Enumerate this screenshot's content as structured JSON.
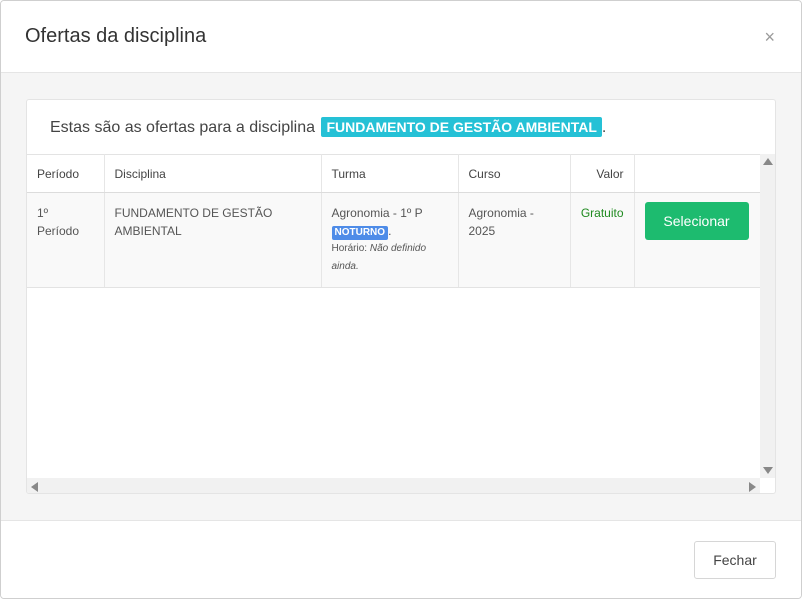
{
  "modal": {
    "title": "Ofertas da disciplina",
    "close_label": "×"
  },
  "intro": {
    "text": "Estas são as ofertas para a disciplina",
    "discipline_tag": "FUNDAMENTO DE GESTÃO AMBIENTAL",
    "suffix": "."
  },
  "table": {
    "headers": [
      "Período",
      "Disciplina",
      "Turma",
      "Curso",
      "Valor",
      ""
    ],
    "rows": [
      {
        "periodo_line1": "1º",
        "periodo_line2": "Período",
        "disciplina_line1": "FUNDAMENTO DE GESTÃO",
        "disciplina_line2": "AMBIENTAL",
        "turma": "Agronomia - 1º P",
        "turno_badge": "NOTURNO",
        "turno_suffix": ".",
        "horario_label": "Horário:",
        "horario_value_line1": "Não definido",
        "horario_value_line2": "ainda.",
        "curso_line1": "Agronomia -",
        "curso_line2": "2025",
        "valor": "Gratuito",
        "action_label": "Selecionar"
      }
    ]
  },
  "footer": {
    "close_button": "Fechar"
  },
  "colors": {
    "tag_bg": "#25c1d6",
    "badge_bg": "#4e8ce8",
    "select_button_bg": "#1dbb6f",
    "gratuito_text": "#1f8a1f"
  }
}
